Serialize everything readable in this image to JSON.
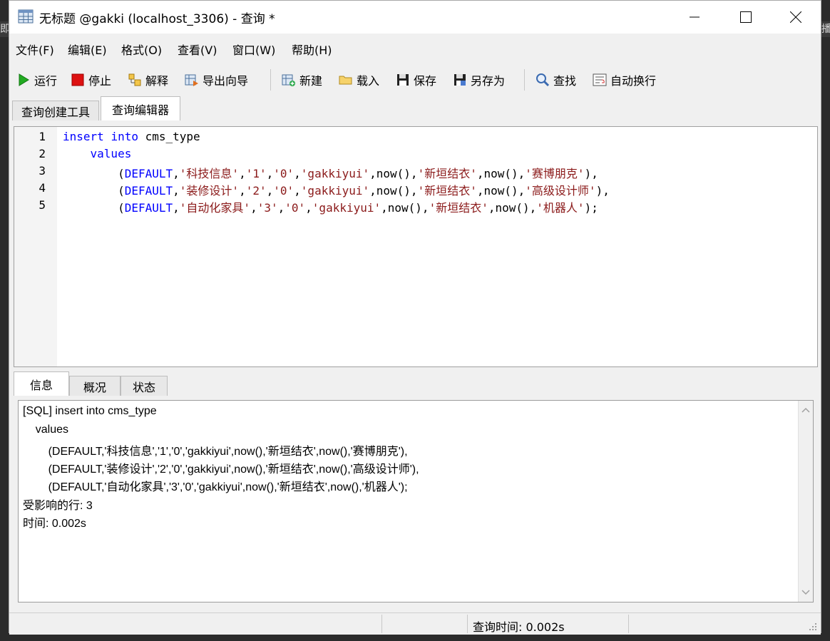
{
  "window": {
    "title": "无标题 @gakki (localhost_3306) - 查询 *"
  },
  "menu": [
    "文件(F)",
    "编辑(E)",
    "格式(O)",
    "查看(V)",
    "窗口(W)",
    "帮助(H)"
  ],
  "toolbar": {
    "run": "运行",
    "stop": "停止",
    "explain": "解释",
    "export_wizard": "导出向导",
    "new": "新建",
    "load": "载入",
    "save": "保存",
    "save_as": "另存为",
    "find": "查找",
    "word_wrap": "自动换行"
  },
  "editor_tabs": [
    "查询创建工具",
    "查询编辑器"
  ],
  "editor": {
    "line_numbers": [
      "1",
      "2",
      "3",
      "4",
      "5"
    ],
    "lines": {
      "l1": {
        "kw1": "insert",
        "kw2": "into",
        "rest": " cms_type"
      },
      "l2": {
        "indent": "    ",
        "kw": "values"
      },
      "l3": {
        "indent": "        ",
        "p0": "(",
        "kw": "DEFAULT",
        "p1": ",",
        "s1": "'科技信息'",
        "p2": ",",
        "s2": "'1'",
        "p3": ",",
        "s3": "'0'",
        "p4": ",",
        "s4": "'gakkiyui'",
        "p5": ",now(),",
        "s5": "'新垣结衣'",
        "p6": ",now(),",
        "s6": "'赛博朋克'",
        "p7": "),"
      },
      "l4": {
        "indent": "        ",
        "p0": "(",
        "kw": "DEFAULT",
        "p1": ",",
        "s1": "'装修设计'",
        "p2": ",",
        "s2": "'2'",
        "p3": ",",
        "s3": "'0'",
        "p4": ",",
        "s4": "'gakkiyui'",
        "p5": ",now(),",
        "s5": "'新垣结衣'",
        "p6": ",now(),",
        "s6": "'高级设计师'",
        "p7": "),"
      },
      "l5": {
        "indent": "        ",
        "p0": "(",
        "kw": "DEFAULT",
        "p1": ",",
        "s1": "'自动化家具'",
        "p2": ",",
        "s2": "'3'",
        "p3": ",",
        "s3": "'0'",
        "p4": ",",
        "s4": "'gakkiyui'",
        "p5": ",now(),",
        "s5": "'新垣结衣'",
        "p6": ",now(),",
        "s6": "'机器人'",
        "p7": ");"
      }
    }
  },
  "result_tabs": [
    "信息",
    "概况",
    "状态"
  ],
  "output": [
    "[SQL] insert into cms_type",
    "    values",
    "        (DEFAULT,'科技信息','1','0','gakkiyui',now(),'新垣结衣',now(),'赛博朋克'),",
    "        (DEFAULT,'装修设计','2','0','gakkiyui',now(),'新垣结衣',now(),'高级设计师'),",
    "        (DEFAULT,'自动化家具','3','0','gakkiyui',now(),'新垣结衣',now(),'机器人');",
    "受影响的行: 3",
    "时间: 0.002s"
  ],
  "status": {
    "query_time": "查询时间: 0.002s"
  },
  "background": {
    "left_fragment": "即",
    "right_fragment": "播"
  },
  "colors": {
    "keyword": "#0000ff",
    "string": "#8b1a1a",
    "run_icon": "#22aa22",
    "stop_icon": "#dd1111"
  }
}
